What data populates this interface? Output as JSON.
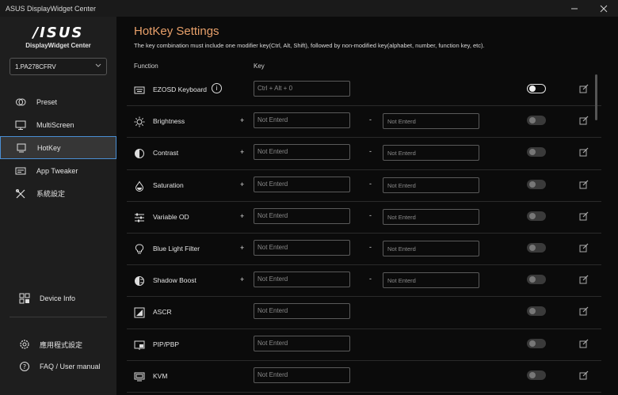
{
  "window": {
    "title": "ASUS DisplayWidget Center"
  },
  "brand": {
    "logo": "/ISUS",
    "product": "DisplayWidget Center"
  },
  "monitor_select": {
    "value": "1.PA278CFRV"
  },
  "nav": [
    {
      "label": "Preset",
      "icon": "circles-icon",
      "active": false
    },
    {
      "label": "MultiScreen",
      "icon": "monitor-icon",
      "active": false
    },
    {
      "label": "HotKey",
      "icon": "hotkey-icon",
      "active": true
    },
    {
      "label": "App Tweaker",
      "icon": "app-tweaker-icon",
      "active": false
    },
    {
      "label": "系統設定",
      "icon": "tools-icon",
      "active": false
    }
  ],
  "bottom_nav": {
    "device_info": "Device Info",
    "app_settings": "應用程式設定",
    "faq": "FAQ / User manual"
  },
  "header": {
    "title": "HotKey Settings",
    "subtitle": "The key combination must include one modifier key(Ctrl, Alt, Shift), followed by non-modified key(alphabet, number, function key, etc).",
    "col_function": "Function",
    "col_key": "Key"
  },
  "rows": [
    {
      "name": "EZOSD Keyboard",
      "icon": "keyboard-icon",
      "info": "i",
      "key1": "Ctrl + Alt + 0",
      "toggle_on": true
    },
    {
      "name": "Brightness",
      "icon": "sun-icon",
      "plus": "+",
      "key1": "Not Enterd",
      "dash": "-",
      "key2": "Not Enterd"
    },
    {
      "name": "Contrast",
      "icon": "contrast-icon",
      "plus": "+",
      "key1": "Not Enterd",
      "dash": "-",
      "key2": "Not Enterd"
    },
    {
      "name": "Saturation",
      "icon": "droplet-icon",
      "plus": "+",
      "key1": "Not Enterd",
      "dash": "-",
      "key2": "Not Enterd"
    },
    {
      "name": "Variable OD",
      "icon": "sliders-icon",
      "plus": "+",
      "key1": "Not Enterd",
      "dash": "-",
      "key2": "Not Enterd"
    },
    {
      "name": "Blue Light Filter",
      "icon": "bulb-icon",
      "plus": "+",
      "key1": "Not Enterd",
      "dash": "-",
      "key2": "Not Enterd"
    },
    {
      "name": "Shadow Boost",
      "icon": "shadow-boost-icon",
      "plus": "+",
      "key1": "Not Enterd",
      "dash": "-",
      "key2": "Not Enterd"
    },
    {
      "name": "ASCR",
      "icon": "ascr-icon",
      "key1": "Not Enterd"
    },
    {
      "name": "PIP/PBP",
      "icon": "pip-icon",
      "key1": "Not Enterd"
    },
    {
      "name": "KVM",
      "icon": "kvm-icon",
      "key1": "Not Enterd"
    }
  ],
  "colors": {
    "accent": "#e8a06a",
    "active_border": "#4a8fd4"
  }
}
